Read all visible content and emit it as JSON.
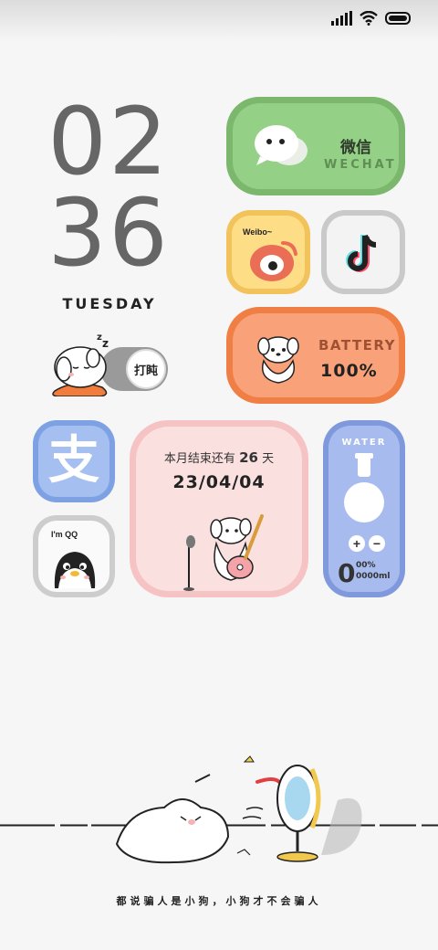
{
  "status_bar": {
    "signal_icon": "signal-icon",
    "wifi_icon": "wifi-icon",
    "battery_icon": "battery-icon"
  },
  "clock": {
    "hours": "02",
    "minutes": "36",
    "day": "TUESDAY"
  },
  "sleep_toggle": {
    "label": "打盹",
    "icon": "sleeping-dog-icon"
  },
  "wechat": {
    "title": "微信",
    "subtitle": "WECHAT",
    "color": "#7bb76d"
  },
  "weibo": {
    "label": "Weibo~",
    "color": "#f2c25b"
  },
  "tiktok": {
    "icon": "tiktok-icon"
  },
  "battery_widget": {
    "label": "BATTERY",
    "value": "100%",
    "color": "#f07f45"
  },
  "alipay": {
    "glyph": "支",
    "color": "#7ea1e4"
  },
  "qq": {
    "label": "I'm QQ"
  },
  "countdown": {
    "prefix": "本月结束还有",
    "days": "26",
    "suffix": "天",
    "date": "23/04/04"
  },
  "water": {
    "title": "WATER",
    "big_digit": "0",
    "percent": "00%",
    "amount": "0000ml",
    "plus": "+",
    "minus": "−"
  },
  "caption": "都说骗人是小狗，小狗才不会骗人"
}
